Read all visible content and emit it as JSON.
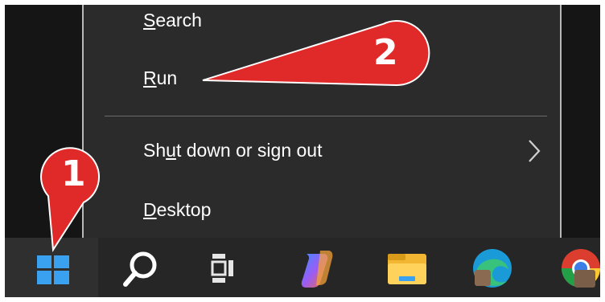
{
  "context_menu": {
    "items": [
      {
        "pre": "",
        "key": "S",
        "post": "earch"
      },
      {
        "pre": "",
        "key": "R",
        "post": "un"
      },
      {
        "pre": "Sh",
        "key": "u",
        "post": "t down or sign out"
      },
      {
        "pre": "",
        "key": "D",
        "post": "esktop"
      }
    ],
    "submenu_icon": "chevron-right-icon"
  },
  "callouts": [
    {
      "number": "1",
      "target": "start-button",
      "color": "#e02a2a"
    },
    {
      "number": "2",
      "target": "menu-item-run",
      "color": "#e02a2a"
    }
  ],
  "taskbar": {
    "icons": [
      "windows-start-icon",
      "search-icon",
      "task-view-icon",
      "copilot-icon",
      "file-explorer-icon",
      "edge-icon",
      "chrome-icon"
    ]
  },
  "colors": {
    "menu_bg": "#2b2b2b",
    "taskbar_bg": "#262626",
    "windows_blue": "#3aa0f0",
    "callout_red": "#e02a2a"
  }
}
